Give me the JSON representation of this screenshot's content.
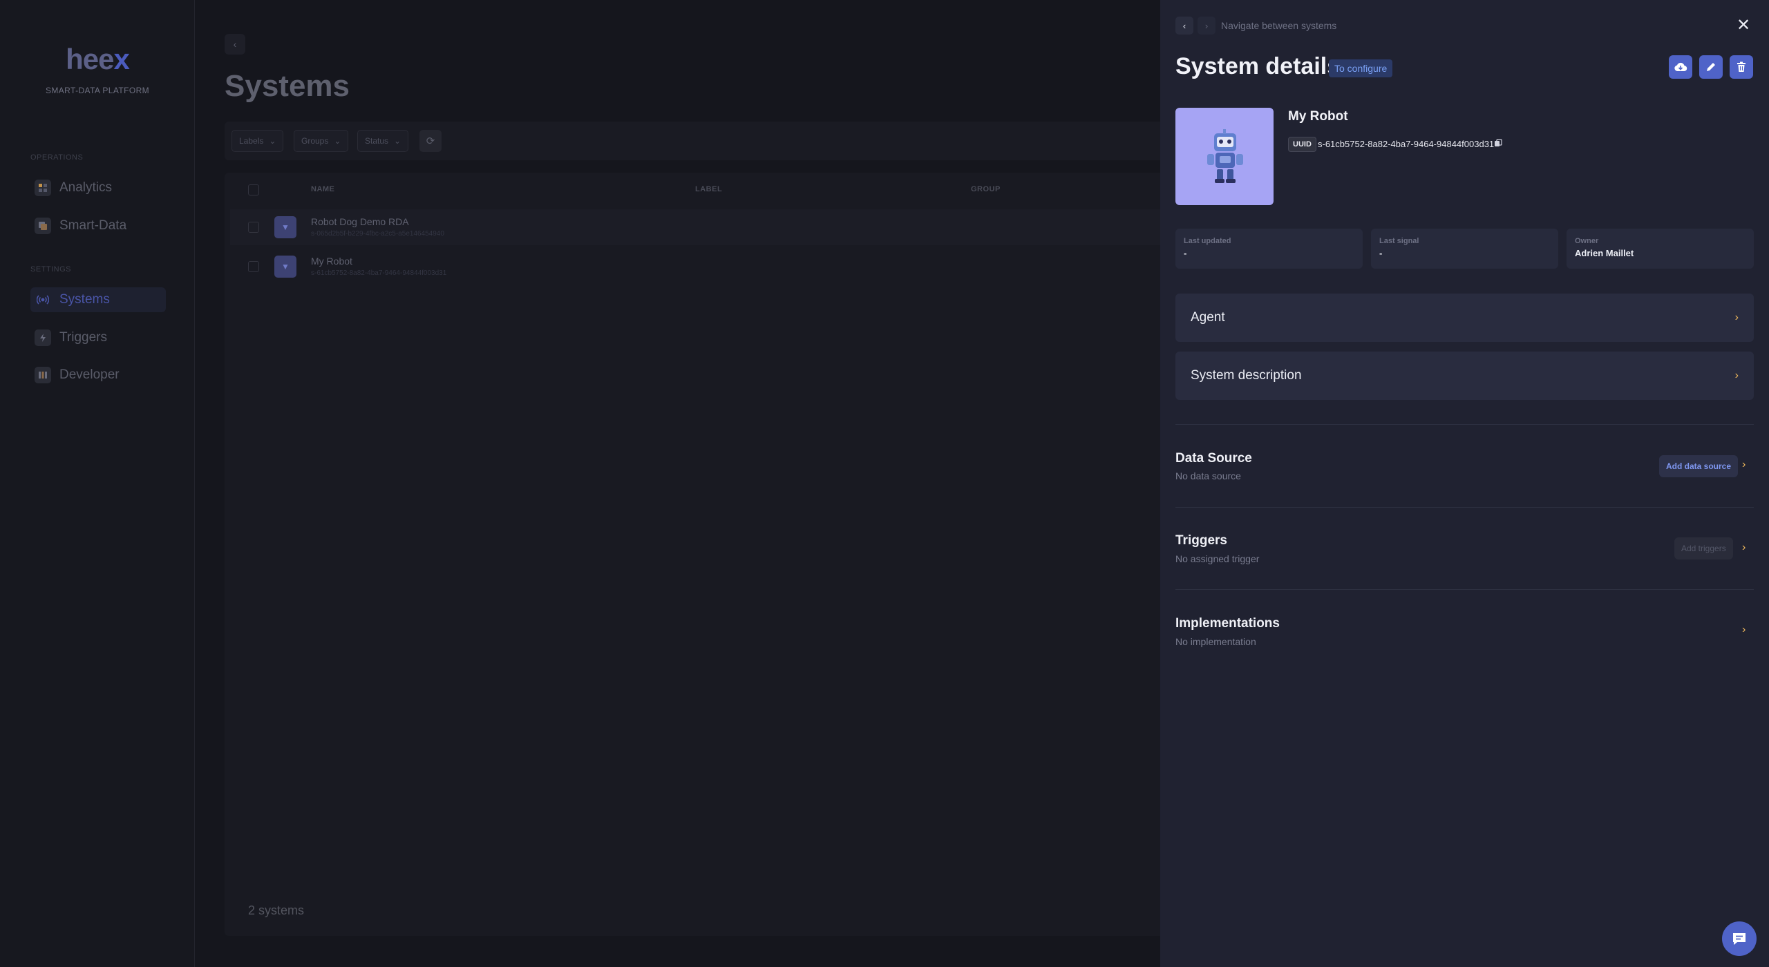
{
  "sidebar": {
    "logo_main": "hee",
    "logo_x": "x",
    "logo_sub": "SMART-DATA PLATFORM",
    "sections": {
      "operations": "OPERATIONS",
      "settings": "SETTINGS"
    },
    "items": [
      {
        "label": "Analytics",
        "icon": "analytics-icon"
      },
      {
        "label": "Smart-Data",
        "icon": "smart-data-icon"
      },
      {
        "label": "Systems",
        "icon": "systems-icon",
        "active": true
      },
      {
        "label": "Triggers",
        "icon": "triggers-icon"
      },
      {
        "label": "Developer",
        "icon": "developer-icon"
      }
    ]
  },
  "main": {
    "title": "Systems",
    "filters": {
      "labels": "Labels",
      "groups": "Groups",
      "status": "Status"
    },
    "table": {
      "headers": {
        "name": "NAME",
        "label": "LABEL",
        "group": "GROUP"
      },
      "rows": [
        {
          "name": "Robot Dog Demo RDA",
          "id": "s-065d2b5f-b229-4fbc-a2c5-a5e146454940"
        },
        {
          "name": "My Robot",
          "id": "s-61cb5752-8a82-4ba7-9464-94844f003d31"
        }
      ]
    },
    "count": "2 systems"
  },
  "panel": {
    "nav_hint": "Navigate between systems",
    "title": "System details",
    "status": "To configure",
    "system_name": "My Robot",
    "uuid_label": "UUID",
    "uuid_value": "s-61cb5752-8a82-4ba7-9464-94844f003d31",
    "info": {
      "last_updated_label": "Last updated",
      "last_updated_value": "-",
      "last_signal_label": "Last signal",
      "last_signal_value": "-",
      "owner_label": "Owner",
      "owner_value": "Adrien Maillet"
    },
    "accordions": {
      "agent": "Agent",
      "description": "System description"
    },
    "data_source": {
      "title": "Data Source",
      "sub": "No data source",
      "button": "Add data source"
    },
    "triggers": {
      "title": "Triggers",
      "sub": "No assigned trigger",
      "button": "Add triggers"
    },
    "implementations": {
      "title": "Implementations",
      "sub": "No implementation"
    }
  },
  "colors": {
    "accent": "#4f63c8",
    "badge": "#7aa0f4",
    "chevron": "#f0b95c",
    "panel_bg": "#202231"
  }
}
